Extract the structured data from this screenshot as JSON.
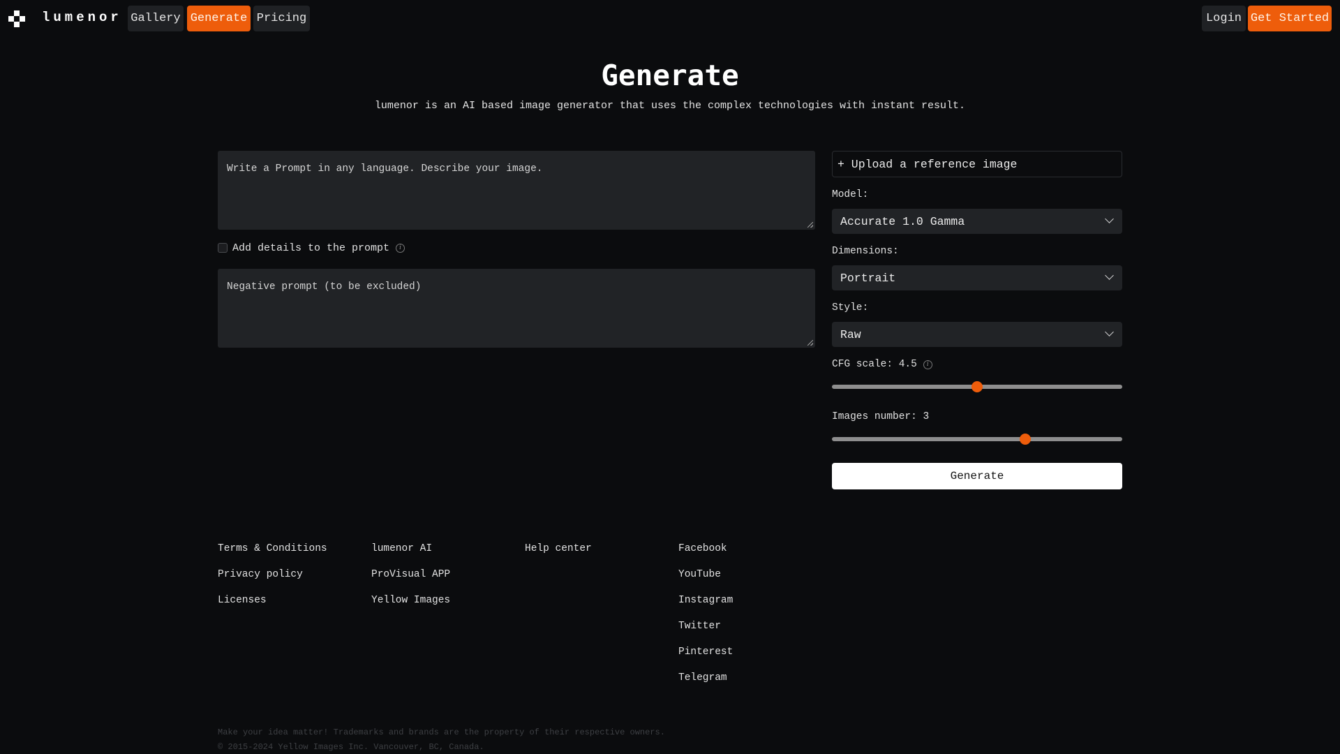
{
  "nav": {
    "brand": "lumenor",
    "logo_icon": "checker-cross-logo",
    "links": [
      {
        "label": "Gallery",
        "active": false
      },
      {
        "label": "Generate",
        "active": true
      },
      {
        "label": "Pricing",
        "active": false
      }
    ],
    "login_label": "Login",
    "get_started_label": "Get Started"
  },
  "colors": {
    "accent": "#ee5d0b",
    "background": "#0b0c0e",
    "field": "#212326"
  },
  "header": {
    "title": "Generate",
    "subtitle": "lumenor is an AI based image generator that uses the complex technologies with instant result."
  },
  "form": {
    "prompt_placeholder": "Write a Prompt in any language. Describe your image.",
    "prompt_value": "",
    "add_details_label": "Add details to the prompt",
    "add_details_checked": false,
    "negative_placeholder": "Negative prompt (to be excluded)",
    "negative_value": "",
    "upload_label": "+ Upload a reference image",
    "model_label": "Model:",
    "model_value": "Accurate 1.0 Gamma",
    "dimensions_label": "Dimensions:",
    "dimensions_value": "Portrait",
    "style_label": "Style:",
    "style_value": "Raw",
    "cfg_label": "CFG scale: 4.5",
    "cfg_value": 4.5,
    "cfg_fraction": 0.5,
    "images_label": "Images number: 3",
    "images_value": 3,
    "images_fraction": 0.667,
    "generate_label": "Generate"
  },
  "footer": {
    "columns": [
      [
        "Terms & Conditions",
        "Privacy policy",
        "Licenses"
      ],
      [
        "lumenor AI",
        "ProVisual APP",
        "Yellow Images"
      ],
      [
        "Help center"
      ],
      [
        "Facebook",
        "YouTube",
        "Instagram",
        "Twitter",
        "Pinterest",
        "Telegram"
      ]
    ],
    "legal_line1": "Make your idea matter! Trademarks and brands are the property of their respective owners.",
    "legal_line2": "© 2015-2024 Yellow Images Inc. Vancouver, BC, Canada."
  }
}
